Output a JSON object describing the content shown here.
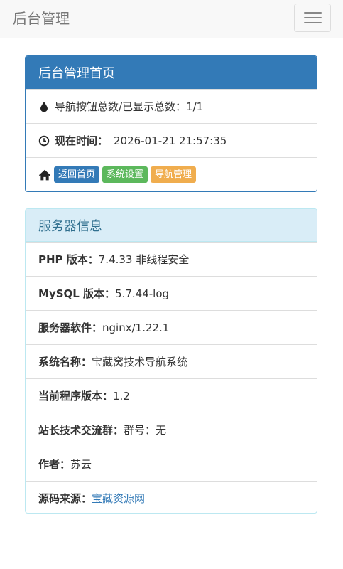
{
  "navbar": {
    "brand": "后台管理",
    "toggle_icon": "hamburger-icon"
  },
  "admin_panel": {
    "title": "后台管理首页",
    "nav_count_label": "导航按钮总数/已显示总数：",
    "nav_count_value": "1/1",
    "time_label": "现在时间：",
    "time_value": "2026-01-21 21:57:35",
    "buttons": {
      "home": "返回首页",
      "settings": "系统设置",
      "nav_manage": "导航管理"
    },
    "icons": {
      "count": "drop-icon",
      "time": "clock-icon",
      "home": "home-icon"
    },
    "colors": {
      "primary": "#337ab7",
      "success": "#5cb85c",
      "warning": "#f0ad4e"
    }
  },
  "server_panel": {
    "title": "服务器信息",
    "php_label": "PHP 版本：",
    "php_value": "7.4.33 非线程安全",
    "mysql_label": "MySQL 版本：",
    "mysql_value": "5.7.44-log",
    "software_label": "服务器软件：",
    "software_value": "nginx/1.22.1",
    "sysname_label": "系统名称：",
    "sysname_value": "宝藏窝技术导航系统",
    "version_label": "当前程序版本：",
    "version_value": "1.2",
    "group_label": "站长技术交流群：",
    "group_value": "群号：无",
    "author_label": "作者：",
    "author_value": "苏云",
    "source_label": "源码来源：",
    "source_value": "宝藏资源网",
    "colors": {
      "heading_bg": "#d9edf7",
      "heading_text": "#31708f"
    }
  }
}
